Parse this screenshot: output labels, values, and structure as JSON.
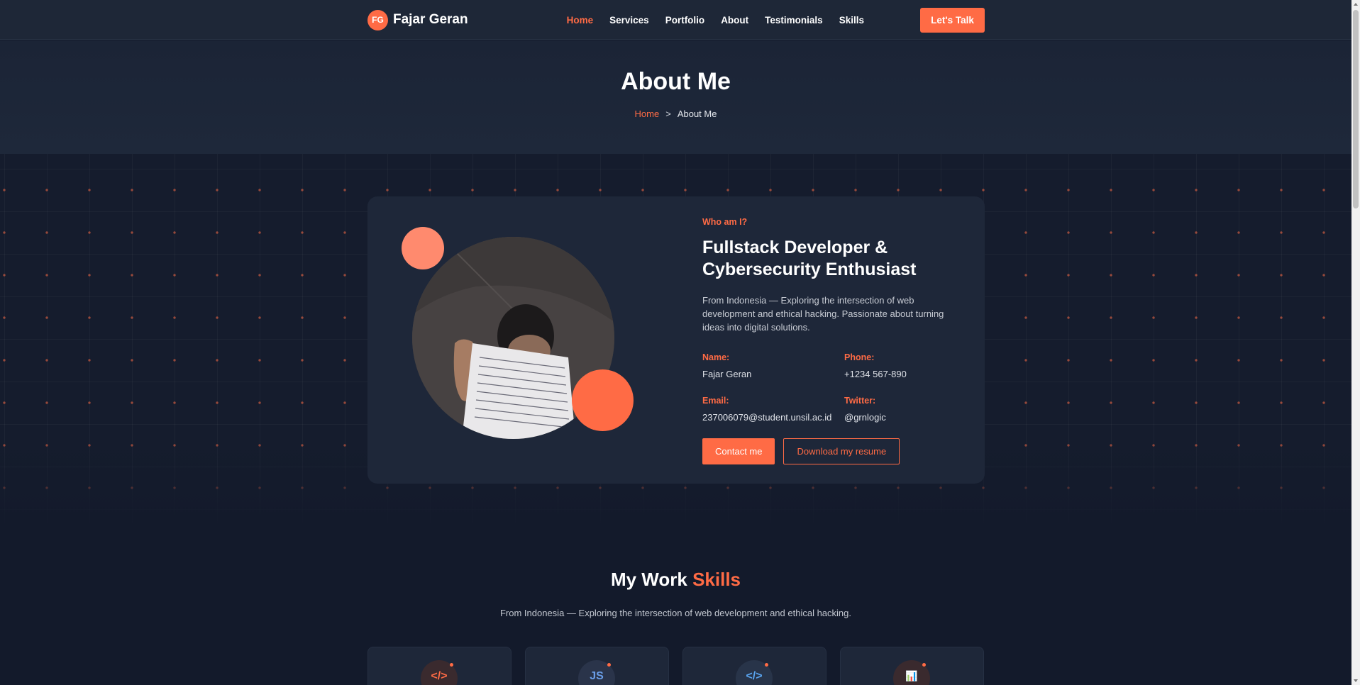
{
  "nav": {
    "brand_mark": "FG",
    "brand_name": "Fajar Geran",
    "links": [
      {
        "label": "Home",
        "active": true
      },
      {
        "label": "Services",
        "active": false
      },
      {
        "label": "Portfolio",
        "active": false
      },
      {
        "label": "About",
        "active": false
      },
      {
        "label": "Testimonials",
        "active": false
      },
      {
        "label": "Skills",
        "active": false
      }
    ],
    "cta_label": "Let's Talk"
  },
  "page_header": {
    "title": "About Me",
    "breadcrumb": {
      "home": "Home",
      "separator": ">",
      "current": "About Me"
    }
  },
  "about": {
    "eyebrow": "Who am I?",
    "heading": "Fullstack Developer & Cybersecurity Enthusiast",
    "description": "From Indonesia — Exploring the intersection of web development and ethical hacking. Passionate about turning ideas into digital solutions.",
    "facts": [
      {
        "label": "Name:",
        "value": "Fajar Geran"
      },
      {
        "label": "Phone:",
        "value": "+1234 567-890"
      },
      {
        "label": "Email:",
        "value": "237006079@student.unsil.ac.id"
      },
      {
        "label": "Twitter:",
        "value": "@grnlogic"
      }
    ],
    "contact_label": "Contact me",
    "resume_label": "Download my resume"
  },
  "skills": {
    "title_main": "My Work",
    "title_accent": "Skills",
    "subtitle": "From Indonesia — Exploring the intersection of web development and ethical hacking.",
    "cards": [
      {
        "icon": "code-icon",
        "glyph": "</>",
        "color": "#ff6b45"
      },
      {
        "icon": "javascript-icon",
        "glyph": "JS",
        "color": "#6a9ee8"
      },
      {
        "icon": "code-brackets-icon",
        "glyph": "</>",
        "color": "#5aa6f2"
      },
      {
        "icon": "chart-icon",
        "glyph": "📊",
        "color": "#ff6b45"
      }
    ]
  },
  "colors": {
    "accent": "#ff6b45",
    "background": "#131a2b",
    "card": "#1e2739",
    "navbar": "#1e2737"
  }
}
